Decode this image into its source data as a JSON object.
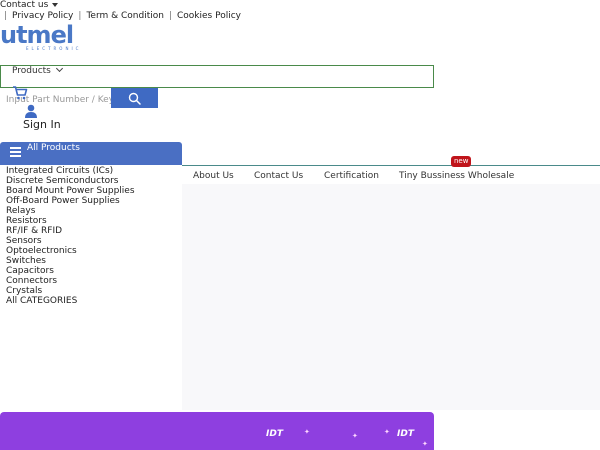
{
  "topbar": {
    "contact_label": "Contact us",
    "links": [
      "Privacy Policy",
      "Term & Condition",
      "Cookies Policy"
    ]
  },
  "logo": {
    "word": "utmel",
    "tagline": "ELECTRONIC"
  },
  "search": {
    "category_label": "Products",
    "placeholder": "Input Part Number / Keywords"
  },
  "account": {
    "signin_label": "Sign In"
  },
  "menu": {
    "all_products_label": "All Products",
    "categories": [
      "Integrated Circuits (ICs)",
      "Discrete Semiconductors",
      "Board Mount Power Supplies",
      "Off-Board Power Supplies",
      "Relays",
      "Resistors",
      "RF/IF & RFID",
      "Sensors",
      "Optoelectronics",
      "Switches",
      "Capacitors",
      "Connectors",
      "Crystals",
      "All CATEGORIES"
    ]
  },
  "nav": {
    "links": [
      "About Us",
      "Contact Us",
      "Certification",
      "Tiny Bussiness Wholesale"
    ],
    "new_badge": "new"
  },
  "banner": {
    "brands": [
      "IDT",
      "IDT"
    ]
  },
  "colors": {
    "brand": "#4a78c6",
    "menu_bar": "#4a6fc3",
    "badge": "#c0141b",
    "banner": "#8e3fe0"
  }
}
